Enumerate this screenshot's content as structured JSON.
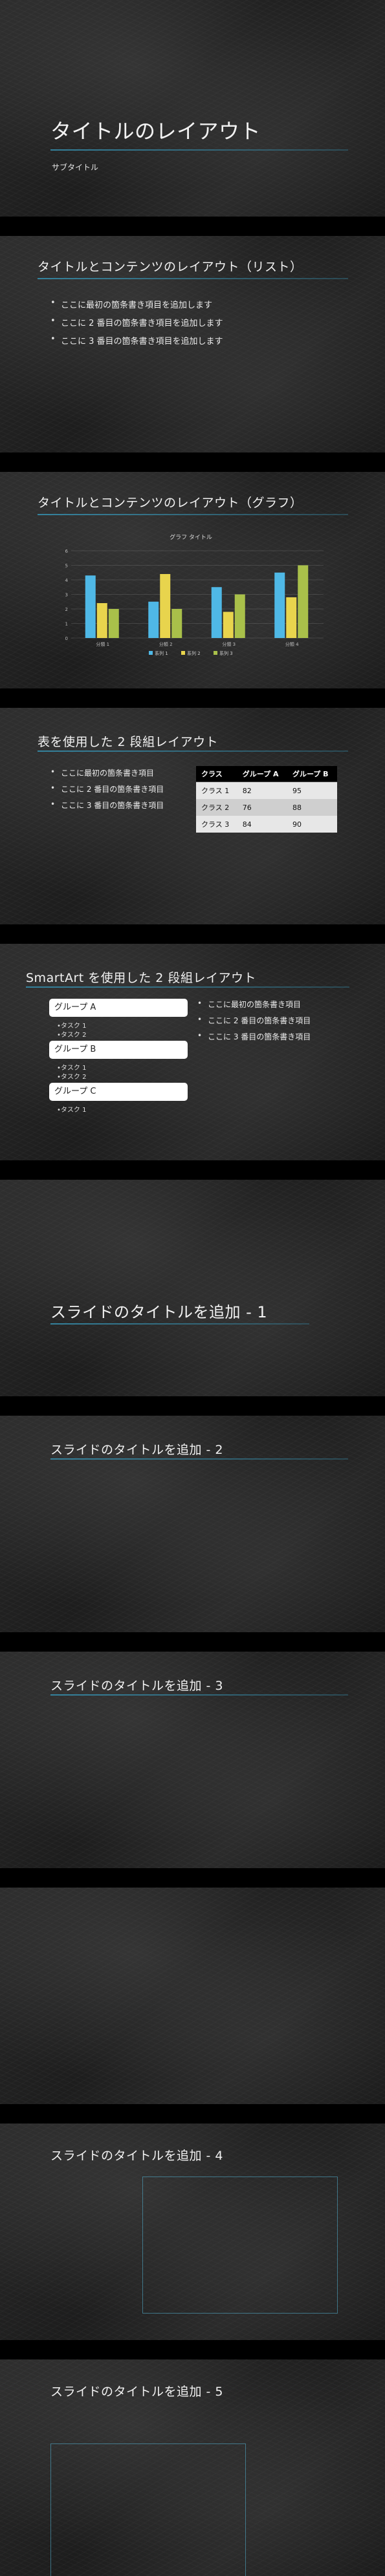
{
  "slides": {
    "s1": {
      "title": "タイトルのレイアウト",
      "subtitle": "サブタイトル"
    },
    "s2": {
      "title": "タイトルとコンテンツのレイアウト（リスト）",
      "bullets": [
        "ここに最初の箇条書き項目を追加します",
        "ここに 2 番目の箇条書き項目を追加します",
        "ここに 3 番目の箇条書き項目を追加します"
      ]
    },
    "s3": {
      "title": "タイトルとコンテンツのレイアウト（グラフ）"
    },
    "s4": {
      "title": "表を使用した 2 段組レイアウト",
      "bullets": [
        "ここに最初の箇条書き項目",
        "ここに 2 番目の箇条書き項目",
        "ここに 3 番目の箇条書き項目"
      ],
      "table": {
        "headers": [
          "クラス",
          "グループ A",
          "グループ B"
        ],
        "rows": [
          [
            "クラス 1",
            "82",
            "95"
          ],
          [
            "クラス 2",
            "76",
            "88"
          ],
          [
            "クラス 3",
            "84",
            "90"
          ]
        ]
      }
    },
    "s5": {
      "title": "SmartArt を使用した 2 段組レイアウト",
      "groups": [
        {
          "label": "グループ A",
          "tasks": [
            "タスク 1",
            "タスク 2"
          ]
        },
        {
          "label": "グループ B",
          "tasks": [
            "タスク 1",
            "タスク 2"
          ]
        },
        {
          "label": "グループ C",
          "tasks": [
            "タスク 1"
          ]
        }
      ],
      "bullets": [
        "ここに最初の箇条書き項目",
        "ここに 2 番目の箇条書き項目",
        "ここに 3 番目の箇条書き項目"
      ]
    },
    "s6": {
      "title": "スライドのタイトルを追加 - 1"
    },
    "s7": {
      "title": "スライドのタイトルを追加 - 2"
    },
    "s8": {
      "title": "スライドのタイトルを追加 - 3"
    },
    "s10": {
      "title": "スライドのタイトルを追加 - 4"
    },
    "s11": {
      "title": "スライドのタイトルを追加 - 5"
    }
  },
  "chart_data": {
    "type": "bar",
    "title": "グラフ タイトル",
    "categories": [
      "分類 1",
      "分類 2",
      "分類 3",
      "分類 4"
    ],
    "series": [
      {
        "name": "系列 1",
        "values": [
          4.3,
          2.5,
          3.5,
          4.5
        ],
        "color": "#4fb8e6"
      },
      {
        "name": "系列 2",
        "values": [
          2.4,
          4.4,
          1.8,
          2.8
        ],
        "color": "#e8d44d"
      },
      {
        "name": "系列 3",
        "values": [
          2.0,
          2.0,
          3.0,
          5.0
        ],
        "color": "#a9c04a"
      }
    ],
    "ylim": [
      0,
      6
    ],
    "yticks": [
      "0",
      "1",
      "2",
      "3",
      "4",
      "5",
      "6"
    ],
    "grid": true,
    "legend": "bottom"
  }
}
